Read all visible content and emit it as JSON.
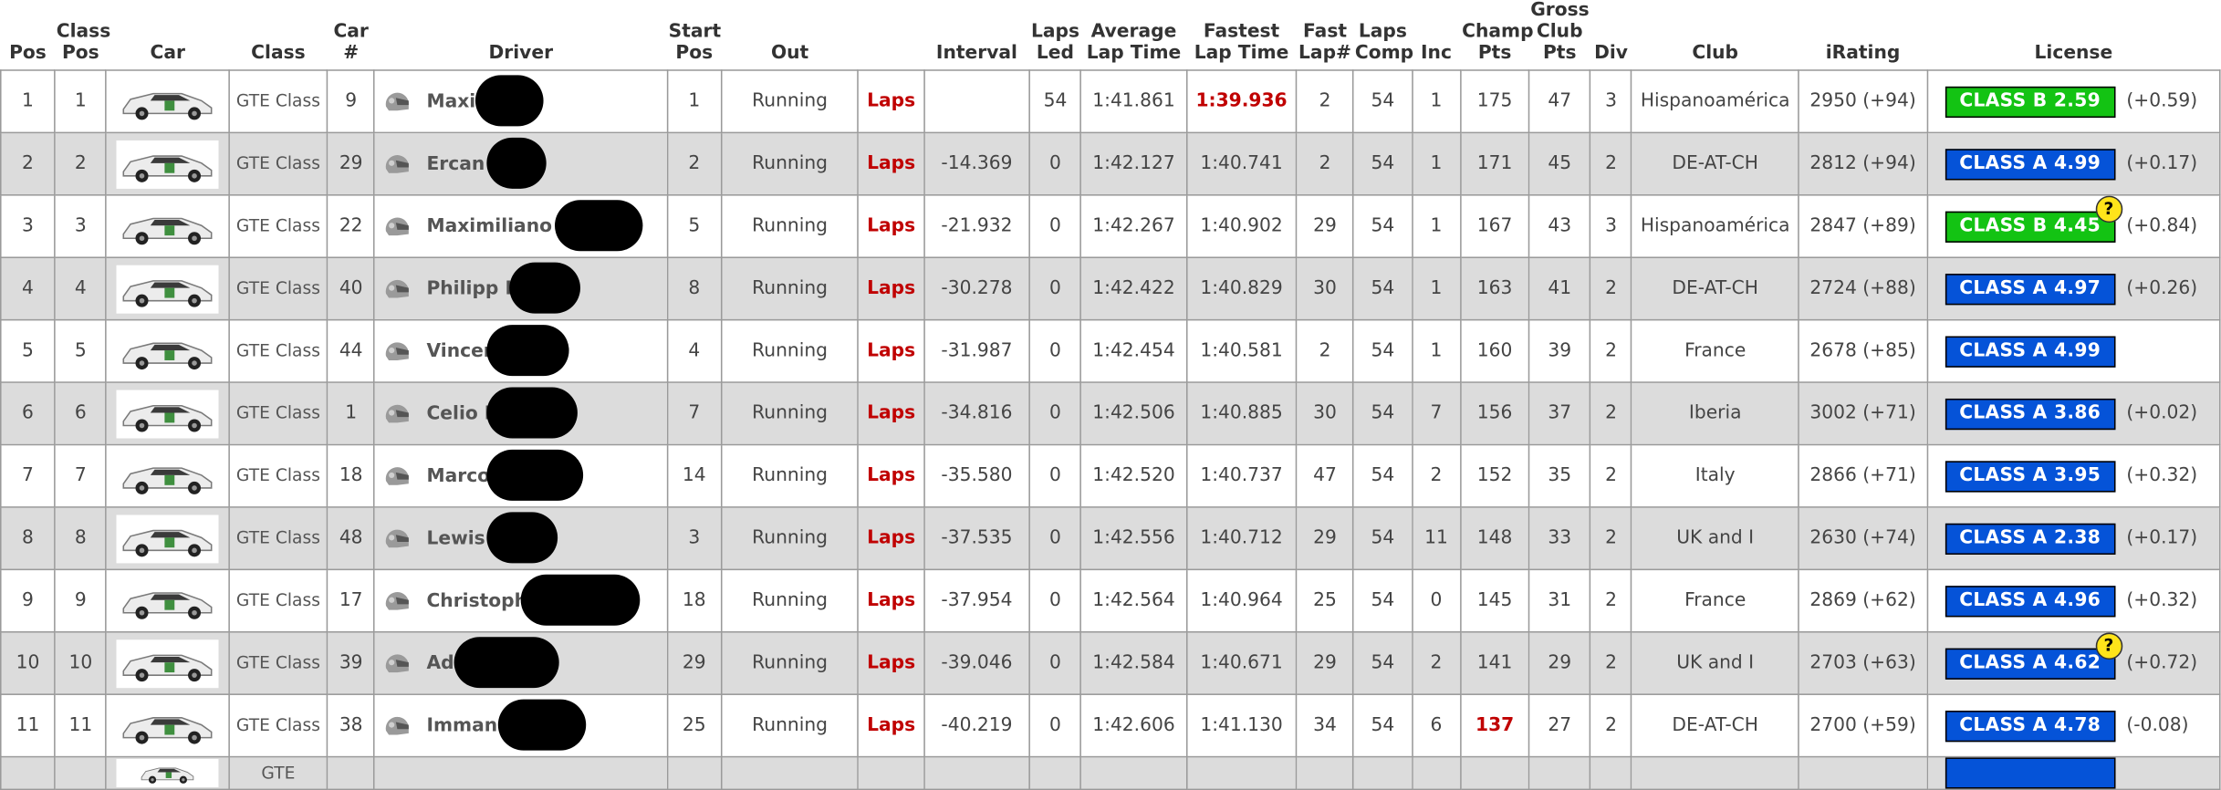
{
  "headers": {
    "pos": "Pos",
    "class_pos": "Class Pos",
    "car": "Car",
    "class": "Class",
    "car_num": "Car #",
    "driver": "Driver",
    "start_pos": "Start Pos",
    "out": "Out",
    "laps_col": "",
    "interval": "Interval",
    "laps_led": "Laps Led",
    "avg_lap": "Average Lap Time",
    "fastest_lap": "Fastest Lap Time",
    "fast_lap_num": "Fast Lap#",
    "laps_comp": "Laps Comp",
    "inc": "Inc",
    "champ_pts": "Champ Pts",
    "gross_club_pts": "Gross Club Pts",
    "div": "Div",
    "club": "Club",
    "irating": "iRating",
    "license": "License"
  },
  "colors": {
    "class_a": "#0553d8",
    "class_b": "#13c313",
    "highlight_red": "#c00000",
    "row_alt": "#dcdcdc"
  },
  "icons": {
    "helmet": "helmet-icon",
    "car": "car-image",
    "help": "question-mark-icon"
  },
  "rows": [
    {
      "pos": "1",
      "class_pos": "1",
      "class": "GTE Class",
      "car_num": "9",
      "driver": "Maxi J",
      "start_pos": "1",
      "out": "Running",
      "laps": "Laps",
      "interval": "",
      "laps_led": "54",
      "avg_lap": "1:41.861",
      "fastest_lap": "1:39.936",
      "fast_lap_num": "2",
      "laps_comp": "54",
      "inc": "1",
      "champ_pts": "175",
      "gross_club_pts": "47",
      "div": "3",
      "club": "Hispanoamérica",
      "irating": "2950 (+94)",
      "license": "CLASS B 2.59",
      "license_delta": "(+0.59)",
      "license_class": "B",
      "help": ""
    },
    {
      "pos": "2",
      "class_pos": "2",
      "class": "GTE Class",
      "car_num": "29",
      "driver": "Ercan E",
      "start_pos": "2",
      "out": "Running",
      "laps": "Laps",
      "interval": "-14.369",
      "laps_led": "0",
      "avg_lap": "1:42.127",
      "fastest_lap": "1:40.741",
      "fast_lap_num": "2",
      "laps_comp": "54",
      "inc": "1",
      "champ_pts": "171",
      "gross_club_pts": "45",
      "div": "2",
      "club": "DE-AT-CH",
      "irating": "2812 (+94)",
      "license": "CLASS A 4.99",
      "license_delta": "(+0.17)",
      "license_class": "A",
      "help": ""
    },
    {
      "pos": "3",
      "class_pos": "3",
      "class": "GTE Class",
      "car_num": "22",
      "driver": "Maximiliano R",
      "start_pos": "5",
      "out": "Running",
      "laps": "Laps",
      "interval": "-21.932",
      "laps_led": "0",
      "avg_lap": "1:42.267",
      "fastest_lap": "1:40.902",
      "fast_lap_num": "29",
      "laps_comp": "54",
      "inc": "1",
      "champ_pts": "167",
      "gross_club_pts": "43",
      "div": "3",
      "club": "Hispanoamérica",
      "irating": "2847 (+89)",
      "license": "CLASS B 4.45",
      "license_delta": "(+0.84)",
      "license_class": "B",
      "help": "?"
    },
    {
      "pos": "4",
      "class_pos": "4",
      "class": "GTE Class",
      "car_num": "40",
      "driver": "Philipp H",
      "start_pos": "8",
      "out": "Running",
      "laps": "Laps",
      "interval": "-30.278",
      "laps_led": "0",
      "avg_lap": "1:42.422",
      "fastest_lap": "1:40.829",
      "fast_lap_num": "30",
      "laps_comp": "54",
      "inc": "1",
      "champ_pts": "163",
      "gross_club_pts": "41",
      "div": "2",
      "club": "DE-AT-CH",
      "irating": "2724 (+88)",
      "license": "CLASS A 4.97",
      "license_delta": "(+0.26)",
      "license_class": "A",
      "help": ""
    },
    {
      "pos": "5",
      "class_pos": "5",
      "class": "GTE Class",
      "car_num": "44",
      "driver": "Vincent",
      "start_pos": "4",
      "out": "Running",
      "laps": "Laps",
      "interval": "-31.987",
      "laps_led": "0",
      "avg_lap": "1:42.454",
      "fastest_lap": "1:40.581",
      "fast_lap_num": "2",
      "laps_comp": "54",
      "inc": "1",
      "champ_pts": "160",
      "gross_club_pts": "39",
      "div": "2",
      "club": "France",
      "irating": "2678 (+85)",
      "license": "CLASS A 4.99",
      "license_delta": "",
      "license_class": "A",
      "help": ""
    },
    {
      "pos": "6",
      "class_pos": "6",
      "class": "GTE Class",
      "car_num": "1",
      "driver": "Celio M",
      "start_pos": "7",
      "out": "Running",
      "laps": "Laps",
      "interval": "-34.816",
      "laps_led": "0",
      "avg_lap": "1:42.506",
      "fastest_lap": "1:40.885",
      "fast_lap_num": "30",
      "laps_comp": "54",
      "inc": "7",
      "champ_pts": "156",
      "gross_club_pts": "37",
      "div": "2",
      "club": "Iberia",
      "irating": "3002 (+71)",
      "license": "CLASS A 3.86",
      "license_delta": "(+0.02)",
      "license_class": "A",
      "help": ""
    },
    {
      "pos": "7",
      "class_pos": "7",
      "class": "GTE Class",
      "car_num": "18",
      "driver": "Marco F",
      "start_pos": "14",
      "out": "Running",
      "laps": "Laps",
      "interval": "-35.580",
      "laps_led": "0",
      "avg_lap": "1:42.520",
      "fastest_lap": "1:40.737",
      "fast_lap_num": "47",
      "laps_comp": "54",
      "inc": "2",
      "champ_pts": "152",
      "gross_club_pts": "35",
      "div": "2",
      "club": "Italy",
      "irating": "2866 (+71)",
      "license": "CLASS A 3.95",
      "license_delta": "(+0.32)",
      "license_class": "A",
      "help": ""
    },
    {
      "pos": "8",
      "class_pos": "8",
      "class": "GTE Class",
      "car_num": "48",
      "driver": "Lewis S",
      "start_pos": "3",
      "out": "Running",
      "laps": "Laps",
      "interval": "-37.535",
      "laps_led": "0",
      "avg_lap": "1:42.556",
      "fastest_lap": "1:40.712",
      "fast_lap_num": "29",
      "laps_comp": "54",
      "inc": "11",
      "champ_pts": "148",
      "gross_club_pts": "33",
      "div": "2",
      "club": "UK and I",
      "irating": "2630 (+74)",
      "license": "CLASS A 2.38",
      "license_delta": "(+0.17)",
      "license_class": "A",
      "help": ""
    },
    {
      "pos": "9",
      "class_pos": "9",
      "class": "GTE Class",
      "car_num": "17",
      "driver": "Christophe",
      "start_pos": "18",
      "out": "Running",
      "laps": "Laps",
      "interval": "-37.954",
      "laps_led": "0",
      "avg_lap": "1:42.564",
      "fastest_lap": "1:40.964",
      "fast_lap_num": "25",
      "laps_comp": "54",
      "inc": "0",
      "champ_pts": "145",
      "gross_club_pts": "31",
      "div": "2",
      "club": "France",
      "irating": "2869 (+62)",
      "license": "CLASS A 4.96",
      "license_delta": "(+0.32)",
      "license_class": "A",
      "help": ""
    },
    {
      "pos": "10",
      "class_pos": "10",
      "class": "GTE Class",
      "car_num": "39",
      "driver": "Adam",
      "start_pos": "29",
      "out": "Running",
      "laps": "Laps",
      "interval": "-39.046",
      "laps_led": "0",
      "avg_lap": "1:42.584",
      "fastest_lap": "1:40.671",
      "fast_lap_num": "29",
      "laps_comp": "54",
      "inc": "2",
      "champ_pts": "141",
      "gross_club_pts": "29",
      "div": "2",
      "club": "UK and I",
      "irating": "2703 (+63)",
      "license": "CLASS A 4.62",
      "license_delta": "(+0.72)",
      "license_class": "A",
      "help": "?"
    },
    {
      "pos": "11",
      "class_pos": "11",
      "class": "GTE Class",
      "car_num": "38",
      "driver": "Immanuel",
      "start_pos": "25",
      "out": "Running",
      "laps": "Laps",
      "interval": "-40.219",
      "laps_led": "0",
      "avg_lap": "1:42.606",
      "fastest_lap": "1:41.130",
      "fast_lap_num": "34",
      "laps_comp": "54",
      "inc": "6",
      "champ_pts": "137",
      "gross_club_pts": "27",
      "div": "2",
      "club": "DE-AT-CH",
      "irating": "2700 (+59)",
      "license": "CLASS A 4.78",
      "license_delta": "(-0.08)",
      "license_class": "A",
      "help": ""
    },
    {
      "pos": "",
      "class_pos": "",
      "class": "GTE",
      "car_num": "",
      "driver": "",
      "start_pos": "",
      "out": "",
      "laps": "",
      "interval": "",
      "laps_led": "",
      "avg_lap": "",
      "fastest_lap": "",
      "fast_lap_num": "",
      "laps_comp": "",
      "inc": "",
      "champ_pts": "",
      "gross_club_pts": "",
      "div": "",
      "club": "",
      "irating": "",
      "license": "",
      "license_delta": "",
      "license_class": "A",
      "help": ""
    }
  ]
}
